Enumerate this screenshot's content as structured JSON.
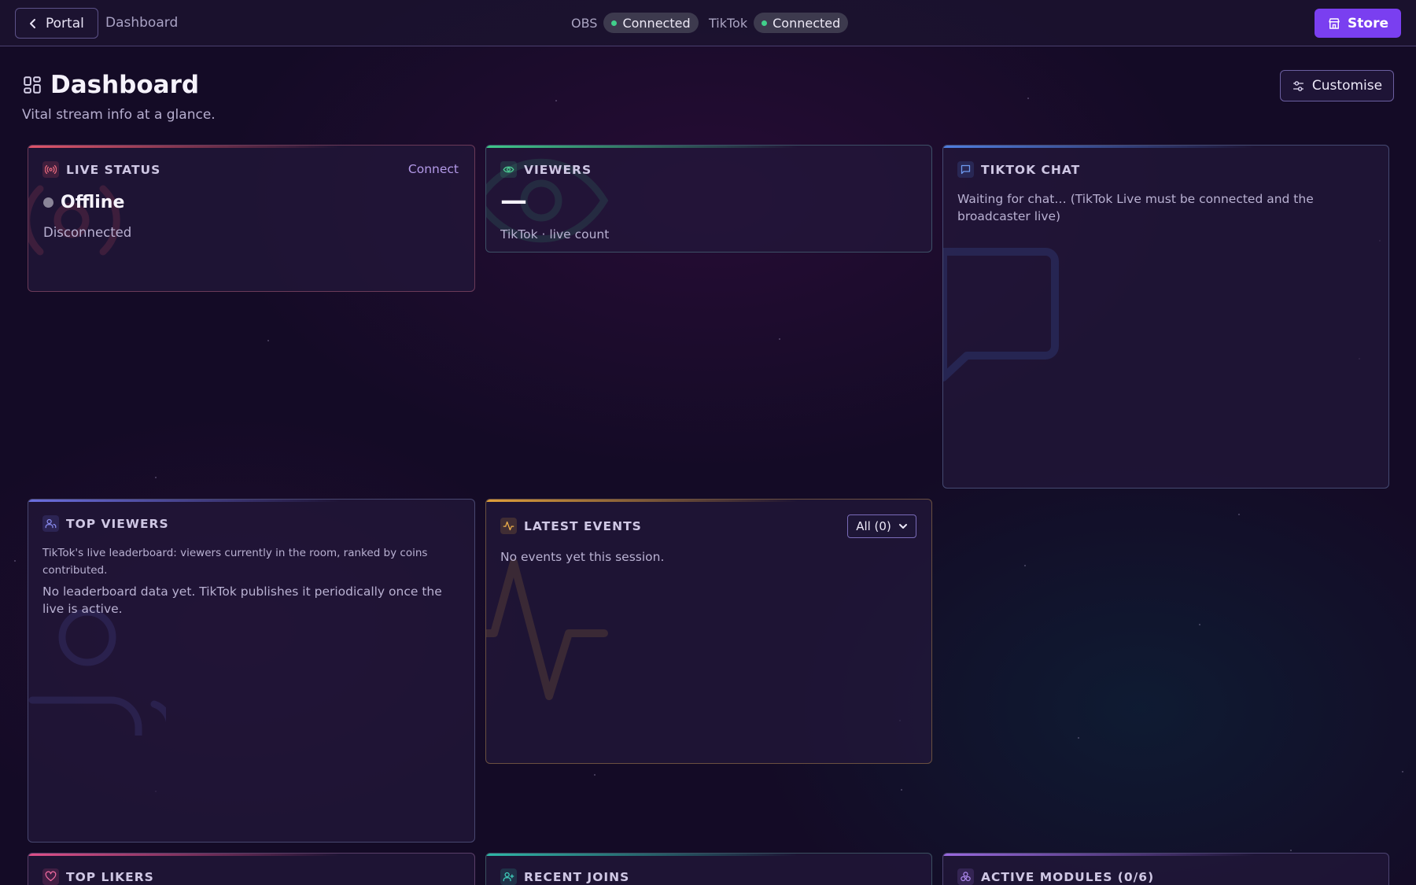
{
  "topbar": {
    "back_label": "Portal",
    "breadcrumb": "Dashboard",
    "obs_label": "OBS",
    "obs_status": "Connected",
    "tiktok_label": "TikTok",
    "tiktok_status": "Connected",
    "store_label": "Store"
  },
  "header": {
    "title": "Dashboard",
    "subtitle": "Vital stream info at a glance.",
    "customise_label": "Customise"
  },
  "cards": {
    "live_status": {
      "title": "LIVE STATUS",
      "action": "Connect",
      "state": "Offline",
      "detail": "Disconnected"
    },
    "viewers": {
      "title": "VIEWERS",
      "value": "—",
      "caption": "TikTok · live count"
    },
    "tiktok_chat": {
      "title": "TIKTOK CHAT",
      "message": "Waiting for chat… (TikTok Live must be connected and the broadcaster live)"
    },
    "top_viewers": {
      "title": "TOP VIEWERS",
      "description": "TikTok's live leaderboard: viewers currently in the room, ranked by coins contributed.",
      "empty": "No leaderboard data yet. TikTok publishes it periodically once the live is active."
    },
    "latest_events": {
      "title": "LATEST EVENTS",
      "filter": "All (0)",
      "empty": "No events yet this session."
    },
    "top_likers": {
      "title": "TOP LIKERS"
    },
    "recent_joins": {
      "title": "RECENT JOINS"
    },
    "active_modules": {
      "title": "ACTIVE MODULES (0/6)"
    }
  },
  "colors": {
    "accent_purple": "#7a3ff0",
    "status_green": "#41d08b",
    "live_red": "#e0556a",
    "viewers_green": "#3fc98a",
    "chat_blue": "#4f7fe0",
    "top_viewers_indigo": "#6c6fe0",
    "events_amber": "#e0a03a",
    "likers_pink": "#e0508a",
    "joins_teal": "#2fb8a8",
    "modules_violet": "#9a6ae0"
  },
  "icons": {
    "back": "chevron-left-icon",
    "store": "store-icon",
    "dashboard": "grid-icon",
    "customise": "sliders-icon",
    "live": "broadcast-icon",
    "viewers": "eye-icon",
    "chat": "chat-bubble-icon",
    "top_viewers": "users-icon",
    "events": "activity-icon",
    "likers": "heart-icon",
    "joins": "user-plus-icon",
    "modules": "modules-icon"
  }
}
